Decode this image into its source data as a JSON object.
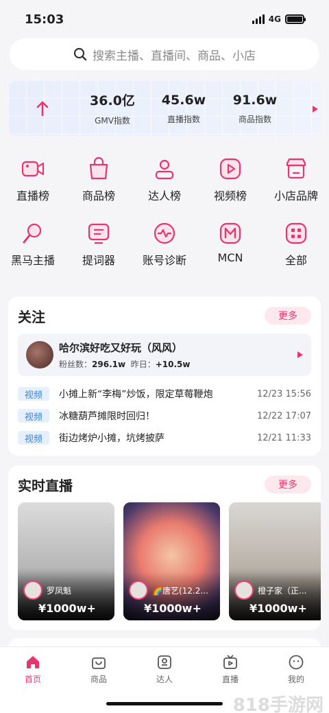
{
  "status": {
    "time": "15:03",
    "network": "4G"
  },
  "search": {
    "placeholder": "搜索主播、直播间、商品、小店"
  },
  "metrics": [
    {
      "value": "36.0亿",
      "label": "GMV指数"
    },
    {
      "value": "45.6w",
      "label": "直播指数"
    },
    {
      "value": "91.6w",
      "label": "商品指数"
    }
  ],
  "grid": [
    {
      "label": "直播榜",
      "icon": "video-camera-icon"
    },
    {
      "label": "商品榜",
      "icon": "shopping-bag-icon"
    },
    {
      "label": "达人榜",
      "icon": "person-icon"
    },
    {
      "label": "视频榜",
      "icon": "play-icon"
    },
    {
      "label": "小店品牌",
      "icon": "store-icon"
    },
    {
      "label": "黑马主播",
      "icon": "magnifier-icon"
    },
    {
      "label": "提词器",
      "icon": "monitor-icon"
    },
    {
      "label": "账号诊断",
      "icon": "heartbeat-icon"
    },
    {
      "label": "MCN",
      "icon": "mcn-icon"
    },
    {
      "label": "全部",
      "icon": "apps-icon"
    }
  ],
  "follow": {
    "title": "关注",
    "more": "更多",
    "anchor": {
      "name": "哈尔滨好吃又好玩（风风）",
      "fans_label": "粉丝数：",
      "fans": "296.1w",
      "yesterday_label": "昨日：",
      "yesterday": "+10.5w"
    },
    "posts": [
      {
        "tag": "视频",
        "title": "小摊上新“李梅”炒饭，限定草莓鞭炮",
        "time": "12/23 15:56"
      },
      {
        "tag": "视频",
        "title": "冰糖葫芦摊限时回归！",
        "time": "12/22 17:07"
      },
      {
        "tag": "视频",
        "title": "街边烤炉小摊，坑烤披萨",
        "time": "12/21 11:33"
      }
    ]
  },
  "live": {
    "title": "实时直播",
    "more": "更多",
    "cards": [
      {
        "name": "罗凤魁",
        "value": "¥1000w+"
      },
      {
        "name": "🌈唐艺(12.2...",
        "value": "¥1000w+"
      },
      {
        "name": "橙子家（正...",
        "value": "¥1000w+"
      }
    ]
  },
  "tabs": [
    {
      "label": "首页",
      "icon": "home-icon",
      "active": true
    },
    {
      "label": "商品",
      "icon": "bag-icon",
      "active": false
    },
    {
      "label": "达人",
      "icon": "id-card-icon",
      "active": false
    },
    {
      "label": "直播",
      "icon": "tv-icon",
      "active": false
    },
    {
      "label": "我的",
      "icon": "smile-icon",
      "active": false
    }
  ],
  "watermark": "818手游网",
  "colors": {
    "accent": "#e8356d",
    "tag_blue": "#3f7fd6"
  }
}
